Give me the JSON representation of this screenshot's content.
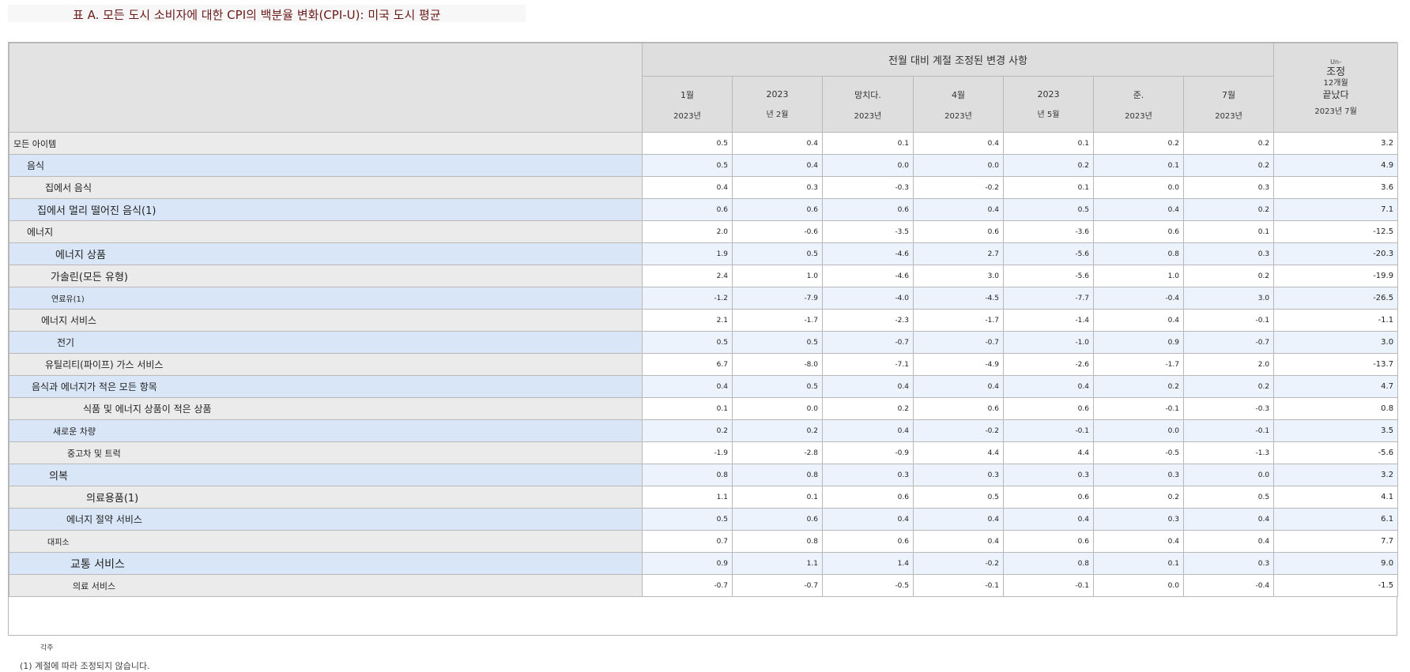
{
  "title": "표 A. 모든 도시 소비자에 대한 CPI의 백분율 변화(CPI-U): 미국 도시 평균",
  "headers": {
    "group": "전월 대비 계절 조정된 변경 사항",
    "months": [
      {
        "l1": "1월",
        "l2": "2023년"
      },
      {
        "l1": "2023",
        "l2": "년 2월"
      },
      {
        "l1": "망치다.",
        "l2": "2023년"
      },
      {
        "l1": "4월",
        "l2": "2023년"
      },
      {
        "l1": "2023",
        "l2": "년 5월"
      },
      {
        "l1": "준.",
        "l2": "2023년"
      },
      {
        "l1": "7월",
        "l2": "2023년"
      }
    ],
    "unadj": {
      "u1": "Un-",
      "u2": "조정",
      "u3": "12개월",
      "u4": "끝났다",
      "u5": "2023년 7월"
    }
  },
  "rows": [
    {
      "label": "모든 아이템",
      "values": [
        "0.5",
        "0.4",
        "0.1",
        "0.4",
        "0.1",
        "0.2",
        "0.2"
      ],
      "yoy": "3.2"
    },
    {
      "label": "음식",
      "values": [
        "0.5",
        "0.4",
        "0.0",
        "0.0",
        "0.2",
        "0.1",
        "0.2"
      ],
      "yoy": "4.9"
    },
    {
      "label": "집에서 음식",
      "values": [
        "0.4",
        "0.3",
        "-0.3",
        "-0.2",
        "0.1",
        "0.0",
        "0.3"
      ],
      "yoy": "3.6"
    },
    {
      "label": "집에서 멀리 떨어진 음식(1)",
      "values": [
        "0.6",
        "0.6",
        "0.6",
        "0.4",
        "0.5",
        "0.4",
        "0.2"
      ],
      "yoy": "7.1"
    },
    {
      "label": "에너지",
      "values": [
        "2.0",
        "-0.6",
        "-3.5",
        "0.6",
        "-3.6",
        "0.6",
        "0.1"
      ],
      "yoy": "-12.5"
    },
    {
      "label": "에너지 상품",
      "values": [
        "1.9",
        "0.5",
        "-4.6",
        "2.7",
        "-5.6",
        "0.8",
        "0.3"
      ],
      "yoy": "-20.3"
    },
    {
      "label": "가솔린(모든 유형)",
      "values": [
        "2.4",
        "1.0",
        "-4.6",
        "3.0",
        "-5.6",
        "1.0",
        "0.2"
      ],
      "yoy": "-19.9"
    },
    {
      "label": "연료유(1)",
      "values": [
        "-1.2",
        "-7.9",
        "-4.0",
        "-4.5",
        "-7.7",
        "-0.4",
        "3.0"
      ],
      "yoy": "-26.5"
    },
    {
      "label": "에너지 서비스",
      "values": [
        "2.1",
        "-1.7",
        "-2.3",
        "-1.7",
        "-1.4",
        "0.4",
        "-0.1"
      ],
      "yoy": "-1.1"
    },
    {
      "label": "전기",
      "values": [
        "0.5",
        "0.5",
        "-0.7",
        "-0.7",
        "-1.0",
        "0.9",
        "-0.7"
      ],
      "yoy": "3.0"
    },
    {
      "label": "유틸리티(파이프) 가스 서비스",
      "values": [
        "6.7",
        "-8.0",
        "-7.1",
        "-4.9",
        "-2.6",
        "-1.7",
        "2.0"
      ],
      "yoy": "-13.7"
    },
    {
      "label": "음식과 에너지가 적은 모든 항목",
      "values": [
        "0.4",
        "0.5",
        "0.4",
        "0.4",
        "0.4",
        "0.2",
        "0.2"
      ],
      "yoy": "4.7"
    },
    {
      "label": "식품 및 에너지 상품이 적은 상품",
      "values": [
        "0.1",
        "0.0",
        "0.2",
        "0.6",
        "0.6",
        "-0.1",
        "-0.3"
      ],
      "yoy": "0.8"
    },
    {
      "label": "새로운 차량",
      "values": [
        "0.2",
        "0.2",
        "0.4",
        "-0.2",
        "-0.1",
        "0.0",
        "-0.1"
      ],
      "yoy": "3.5"
    },
    {
      "label": "중고차 및 트럭",
      "values": [
        "-1.9",
        "-2.8",
        "-0.9",
        "4.4",
        "4.4",
        "-0.5",
        "-1.3"
      ],
      "yoy": "-5.6"
    },
    {
      "label": "의복",
      "values": [
        "0.8",
        "0.8",
        "0.3",
        "0.3",
        "0.3",
        "0.3",
        "0.0"
      ],
      "yoy": "3.2"
    },
    {
      "label": "의료용품(1)",
      "values": [
        "1.1",
        "0.1",
        "0.6",
        "0.5",
        "0.6",
        "0.2",
        "0.5"
      ],
      "yoy": "4.1"
    },
    {
      "label": "에너지 절약 서비스",
      "values": [
        "0.5",
        "0.6",
        "0.4",
        "0.4",
        "0.4",
        "0.3",
        "0.4"
      ],
      "yoy": "6.1"
    },
    {
      "label": "대피소",
      "values": [
        "0.7",
        "0.8",
        "0.6",
        "0.4",
        "0.6",
        "0.4",
        "0.4"
      ],
      "yoy": "7.7"
    },
    {
      "label": "교통 서비스",
      "values": [
        "0.9",
        "1.1",
        "1.4",
        "-0.2",
        "0.8",
        "0.1",
        "0.3"
      ],
      "yoy": "9.0"
    },
    {
      "label": "의료 서비스",
      "values": [
        "-0.7",
        "-0.7",
        "-0.5",
        "-0.1",
        "-0.1",
        "0.0",
        "-0.4"
      ],
      "yoy": "-1.5"
    }
  ],
  "footnotes": {
    "note1": "각주",
    "note2": "(1) 계절에 따라 조정되지 않습니다."
  }
}
